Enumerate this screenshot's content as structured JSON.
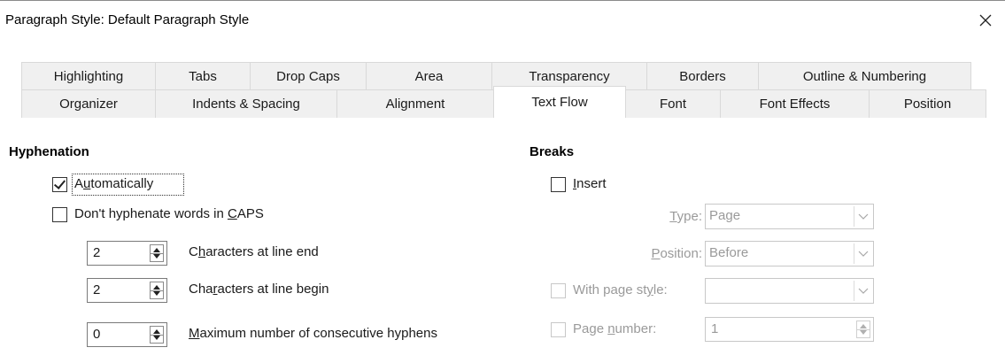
{
  "window": {
    "title": "Paragraph Style: Default Paragraph Style"
  },
  "tabs": {
    "row1": [
      "Highlighting",
      "Tabs",
      "Drop Caps",
      "Area",
      "Transparency",
      "Borders",
      "Outline & Numbering"
    ],
    "row2": [
      "Organizer",
      "Indents & Spacing",
      "Alignment",
      "Text Flow",
      "Font",
      "Font Effects",
      "Position"
    ],
    "active": "Text Flow"
  },
  "hyphenation": {
    "heading": "Hyphenation",
    "automatically": {
      "label": "Automatically",
      "mnemonic": "u",
      "checked": true
    },
    "no_caps": {
      "label_pre": "Don't hyphenate words in ",
      "label_u": "C",
      "label_post": "APS",
      "checked": false
    },
    "chars_end": {
      "value": "2",
      "pre": "C",
      "u": "h",
      "post": "aracters at line end"
    },
    "chars_begin": {
      "value": "2",
      "pre": "Cha",
      "u": "r",
      "post": "acters at line begin"
    },
    "max_hyphens": {
      "value": "0",
      "pre": "",
      "u": "M",
      "post": "aximum number of consecutive hyphens"
    }
  },
  "breaks": {
    "heading": "Breaks",
    "insert": {
      "u": "I",
      "post": "nsert",
      "checked": false
    },
    "type": {
      "u": "T",
      "post": "ype:",
      "value": "Page"
    },
    "position": {
      "u": "P",
      "post": "osition:",
      "value": "Before"
    },
    "with_page_style": {
      "pre": "With page st",
      "u": "y",
      "post": "le:",
      "value": ""
    },
    "page_number": {
      "pre": "Page ",
      "u": "n",
      "post": "umber:",
      "value": "1"
    }
  }
}
